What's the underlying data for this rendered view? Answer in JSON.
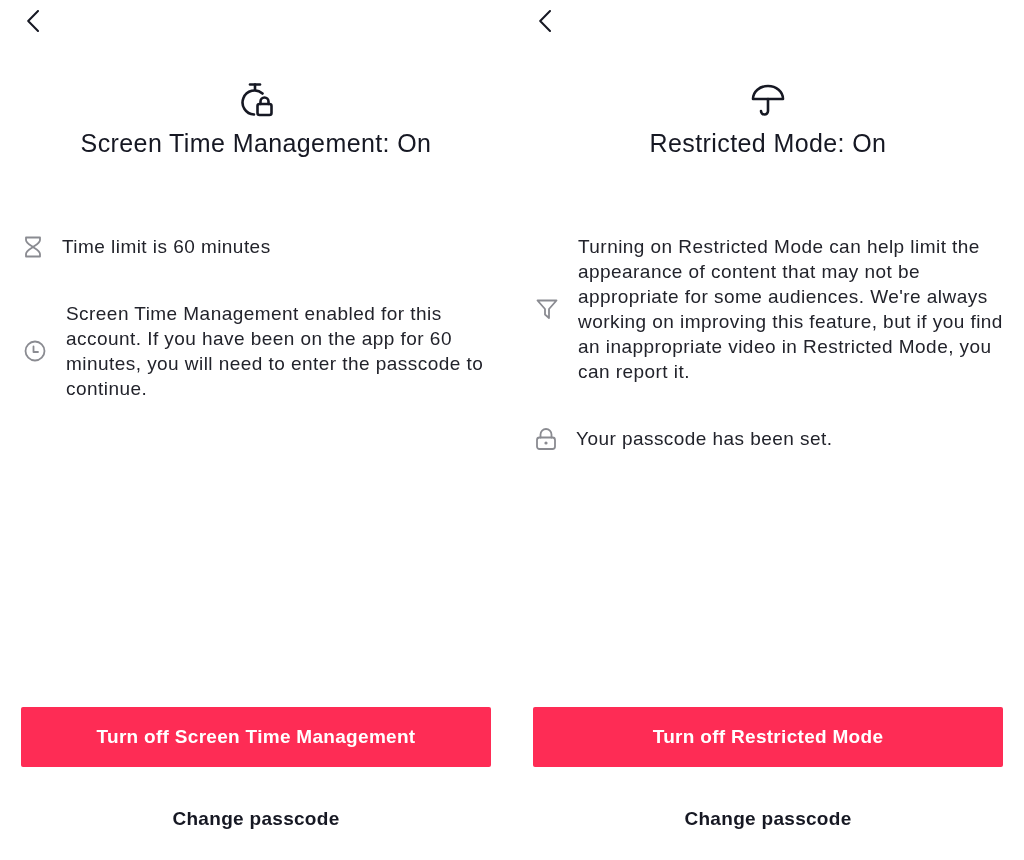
{
  "screens": [
    {
      "kind": "screen_time",
      "title": "Screen Time Management: On",
      "items": [
        {
          "kind": "limit",
          "text": "Time limit is 60 minutes"
        },
        {
          "kind": "timer",
          "text": "Screen Time Management enabled for this account. If you have been on the app for 60 minutes, you will need to enter the passcode to continue."
        }
      ],
      "primary_button": "Turn off Screen Time Management",
      "secondary_link": "Change passcode"
    },
    {
      "kind": "restricted_mode",
      "title": "Restricted Mode: On",
      "items": [
        {
          "kind": "filter",
          "text": "Turning on Restricted Mode can help limit the appearance of content that may not be appropriate for some audiences. We're always working on improving this feature, but if you find an inappropriate video in Restricted Mode, you can report it."
        },
        {
          "kind": "passcode",
          "text": "Your passcode has been set."
        }
      ],
      "primary_button": "Turn off Restricted Mode",
      "secondary_link": "Change passcode"
    }
  ]
}
